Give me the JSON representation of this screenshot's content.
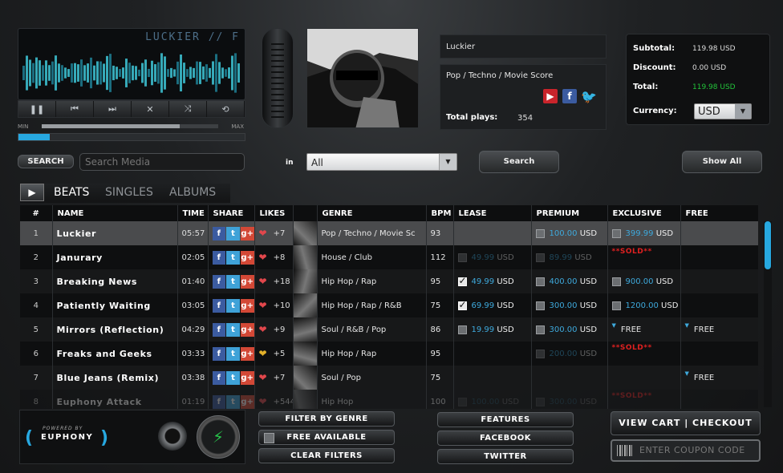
{
  "player": {
    "marquee": "LUCKIER // F",
    "controls": [
      {
        "name": "pause-icon",
        "glyph": "❚❚"
      },
      {
        "name": "previous-icon",
        "glyph": "⏮"
      },
      {
        "name": "next-icon",
        "glyph": "⏭"
      },
      {
        "name": "close-icon",
        "glyph": "✕"
      },
      {
        "name": "shuffle-icon",
        "glyph": "⤨"
      },
      {
        "name": "repeat-icon",
        "glyph": "⟲"
      }
    ],
    "volume_min": "MIN",
    "volume_max": "MAX",
    "volume_level": 0.78,
    "progress": 0.14,
    "accent_color": "#27a8e0"
  },
  "track_info": {
    "title": "Luckier",
    "genre": "Pop / Techno / Movie Score",
    "total_plays_label": "Total plays:",
    "total_plays": "354",
    "social": [
      "youtube-icon",
      "facebook-icon",
      "twitter-icon"
    ]
  },
  "totals": {
    "subtotal_label": "Subtotal:",
    "subtotal": "119.98 USD",
    "discount_label": "Discount:",
    "discount": "0.00 USD",
    "total_label": "Total:",
    "total": "119.98 USD",
    "currency_label": "Currency:",
    "currency": "USD",
    "total_color": "#22c43a"
  },
  "search": {
    "label": "SEARCH",
    "placeholder": "Search Media",
    "in_label": "in",
    "scope": "All",
    "search_button": "Search",
    "show_all_button": "Show All"
  },
  "tabs": {
    "items": [
      "BEATS",
      "SINGLES",
      "ALBUMS"
    ],
    "active": "BEATS"
  },
  "table": {
    "headers": [
      "#",
      "NAME",
      "TIME",
      "SHARE",
      "LIKES",
      "",
      "GENRE",
      "BPM",
      "LEASE",
      "PREMIUM",
      "EXCLUSIVE",
      "FREE"
    ],
    "rows": [
      {
        "num": "1",
        "name": "Luckier",
        "time": "05:57",
        "likes": "+7",
        "heart": "red",
        "genre": "Pop / Techno / Movie Sc",
        "bpm": "93",
        "lease": null,
        "premium": {
          "price": "100.00",
          "cur": "USD",
          "checked": false,
          "disabled": false
        },
        "exclusive": {
          "price": "399.99",
          "cur": "USD",
          "checked": false,
          "disabled": false
        },
        "free": null,
        "exclusive_sold": false
      },
      {
        "num": "2",
        "name": "Janurary",
        "time": "02:05",
        "likes": "+8",
        "heart": "red",
        "genre": "House / Club",
        "bpm": "112",
        "lease": {
          "price": "49.99",
          "cur": "USD",
          "checked": false,
          "disabled": true
        },
        "premium": {
          "price": "89.99",
          "cur": "USD",
          "checked": false,
          "disabled": true
        },
        "exclusive": null,
        "free": null,
        "exclusive_sold": true
      },
      {
        "num": "3",
        "name": "Breaking News",
        "time": "01:40",
        "likes": "+18",
        "heart": "red",
        "genre": "Hip Hop / Rap",
        "bpm": "95",
        "lease": {
          "price": "49.99",
          "cur": "USD",
          "checked": true,
          "disabled": false
        },
        "premium": {
          "price": "400.00",
          "cur": "USD",
          "checked": false,
          "disabled": false
        },
        "exclusive": {
          "price": "900.00",
          "cur": "USD",
          "checked": false,
          "disabled": false
        },
        "free": null,
        "exclusive_sold": false
      },
      {
        "num": "4",
        "name": "Patiently Waiting",
        "time": "03:05",
        "likes": "+10",
        "heart": "red",
        "genre": "Hip Hop / Rap / R&B",
        "bpm": "75",
        "lease": {
          "price": "69.99",
          "cur": "USD",
          "checked": true,
          "disabled": false
        },
        "premium": {
          "price": "300.00",
          "cur": "USD",
          "checked": false,
          "disabled": false
        },
        "exclusive": {
          "price": "1200.00",
          "cur": "USD",
          "checked": false,
          "disabled": false
        },
        "free": null,
        "exclusive_sold": false
      },
      {
        "num": "5",
        "name": "Mirrors (Reflection)",
        "time": "04:29",
        "likes": "+9",
        "heart": "red",
        "genre": "Soul / R&B / Pop",
        "bpm": "86",
        "lease": {
          "price": "19.99",
          "cur": "USD",
          "checked": false,
          "disabled": false
        },
        "premium": {
          "price": "300.00",
          "cur": "USD",
          "checked": false,
          "disabled": false
        },
        "exclusive_free": "FREE",
        "free": "FREE",
        "exclusive": null,
        "exclusive_sold": false
      },
      {
        "num": "6",
        "name": "Freaks and Geeks",
        "time": "03:33",
        "likes": "+5",
        "heart": "gold",
        "genre": "Hip Hop / Rap",
        "bpm": "95",
        "lease": null,
        "premium": {
          "price": "200.00",
          "cur": "USD",
          "checked": false,
          "disabled": true
        },
        "exclusive": null,
        "free": null,
        "exclusive_sold": true
      },
      {
        "num": "7",
        "name": "Blue Jeans (Remix)",
        "time": "03:38",
        "likes": "+7",
        "heart": "red",
        "genre": "Soul / Pop",
        "bpm": "75",
        "lease": null,
        "premium": null,
        "exclusive": null,
        "free": "FREE",
        "exclusive_sold": false
      },
      {
        "num": "8",
        "name": "Euphony Attack",
        "time": "01:19",
        "likes": "+544",
        "heart": "red",
        "genre": "Hip Hop",
        "bpm": "100",
        "lease": {
          "price": "100.00",
          "cur": "USD",
          "checked": false,
          "disabled": true
        },
        "premium": {
          "price": "300.00",
          "cur": "USD",
          "checked": false,
          "disabled": true
        },
        "exclusive": null,
        "free": null,
        "exclusive_sold": true
      }
    ],
    "sold_text": "**SOLD**",
    "selected_row": 0
  },
  "footer": {
    "powered_by": "POWERED BY",
    "brand": "EUPHONY",
    "filter_genre": "FILTER BY GENRE",
    "free_available": "FREE AVAILABLE",
    "clear_filters": "CLEAR FILTERS",
    "features": "FEATURES",
    "facebook": "FACEBOOK",
    "twitter": "TWITTER",
    "view_cart": "VIEW CART | CHECKOUT",
    "coupon_placeholder": "ENTER COUPON CODE"
  }
}
